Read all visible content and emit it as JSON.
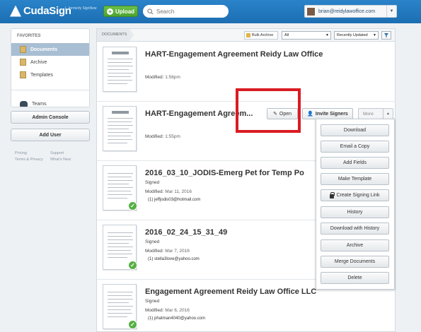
{
  "header": {
    "logo_text": "CudaSign",
    "logo_sub": "formerly SignNow",
    "upload_label": "Upload",
    "search_placeholder": "Search",
    "user_email": "brian@reidylawoffice.com"
  },
  "sidebar": {
    "favorites_title": "FAVORITES",
    "items": [
      {
        "label": "Documents",
        "icon": "folder-icon",
        "active": true
      },
      {
        "label": "Archive",
        "icon": "folder-icon"
      },
      {
        "label": "Templates",
        "icon": "folder-icon"
      }
    ],
    "teams_label": "Teams",
    "admin_console_label": "Admin Console",
    "add_user_label": "Add User",
    "links": [
      "Pricing",
      "Support",
      "Terms & Privacy",
      "What's New"
    ]
  },
  "toolbar": {
    "breadcrumb": "DOCUMENTS",
    "bulk_archive_label": "Bulk Archive",
    "filter_value": "All",
    "sort_value": "Recently Updated"
  },
  "documents": [
    {
      "title": "HART-Engagement Agreement Reidy Law Office",
      "status": "",
      "modified_label": "Modified:",
      "modified": "1:56pm",
      "signer": ""
    },
    {
      "title": "HART-Engagement Agreem...",
      "status": "",
      "modified_label": "Modified:",
      "modified": "1:55pm",
      "signer": ""
    },
    {
      "title": "2016_03_10_JODIS-Emerg Pet for Temp Po",
      "status": "Signed",
      "modified_label": "Modified:",
      "modified": "Mar 11, 2016",
      "signer": "(1) jeffjodis03@hotmail.com"
    },
    {
      "title": "2016_02_24_15_31_49",
      "status": "Signed",
      "modified_label": "Modified:",
      "modified": "Mar 7, 2016",
      "signer": "(1) stella3love@yahoo.com"
    },
    {
      "title": "Engagement Agreement Reidy Law Office LLC",
      "status": "Signed",
      "modified_label": "Modified:",
      "modified": "Mar 6, 2016",
      "signer": "(1) phatman4040@yahoo.com"
    }
  ],
  "row_actions": {
    "open_label": "Open",
    "invite_label": "Invite Signers",
    "more_label": "More"
  },
  "more_menu": [
    "Download",
    "Email a Copy",
    "Add Fields",
    "Make Template",
    "Create Signing Link",
    "History",
    "Download with History",
    "Archive",
    "Merge Documents",
    "Delete"
  ],
  "colors": {
    "header_blue": "#1f76bb",
    "upload_green": "#55a933",
    "highlight_red": "#d91c22",
    "signed_check": "#55b043"
  }
}
